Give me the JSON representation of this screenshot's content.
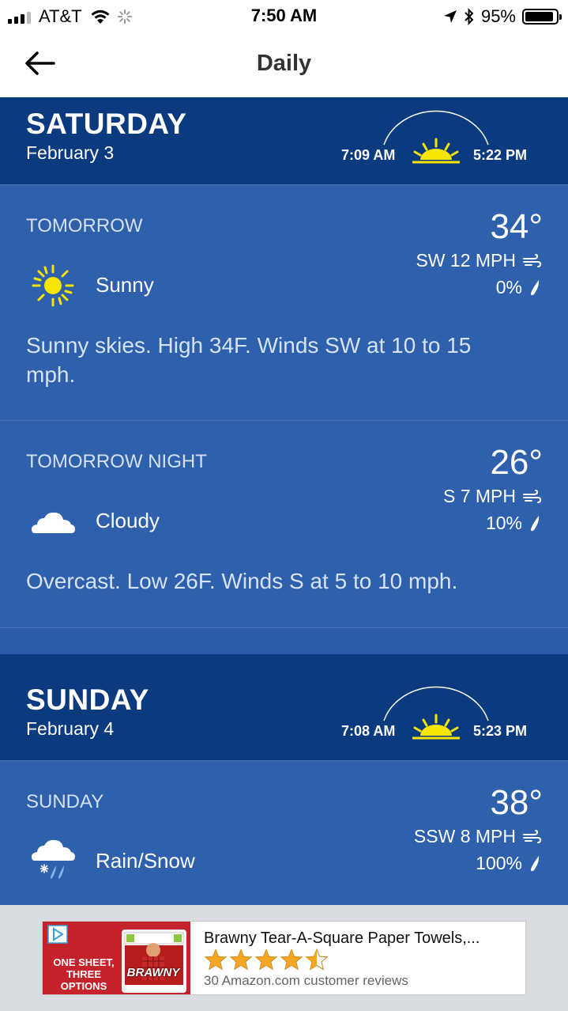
{
  "status": {
    "carrier": "AT&T",
    "time": "7:50 AM",
    "battery": "95%",
    "battery_level": 0.95,
    "signal_bars": 3
  },
  "nav": {
    "title": "Daily"
  },
  "days": [
    {
      "name": "SATURDAY",
      "date": "February 3",
      "sunrise": "7:09 AM",
      "sunset": "5:22 PM",
      "periods": [
        {
          "label": "TOMORROW",
          "temp": "34°",
          "wind": "SW 12 MPH",
          "precip": "0%",
          "icon": "sun-icon",
          "condition": "Sunny",
          "description": "Sunny skies. High 34F. Winds SW at 10 to 15 mph."
        },
        {
          "label": "TOMORROW NIGHT",
          "temp": "26°",
          "wind": "S 7 MPH",
          "precip": "10%",
          "icon": "cloud-icon",
          "condition": "Cloudy",
          "description": "Overcast. Low 26F. Winds S at 5 to 10 mph."
        }
      ]
    },
    {
      "name": "SUNDAY",
      "date": "February 4",
      "sunrise": "7:08 AM",
      "sunset": "5:23 PM",
      "periods": [
        {
          "label": "SUNDAY",
          "temp": "38°",
          "wind": "SSW 8 MPH",
          "precip": "100%",
          "icon": "rain-snow-icon",
          "condition": "Rain/Snow"
        }
      ]
    }
  ],
  "ad": {
    "tagline": "ONE SHEET, THREE OPTIONS",
    "brand": "BRAWNY",
    "title": "Brawny Tear-A-Square Paper Towels,...",
    "rating": 4.5,
    "reviews": "30 Amazon.com customer reviews"
  },
  "colors": {
    "header_bg": "#0b3a7e",
    "content_bg": "#2a5caa",
    "sun": "#f6e500"
  }
}
